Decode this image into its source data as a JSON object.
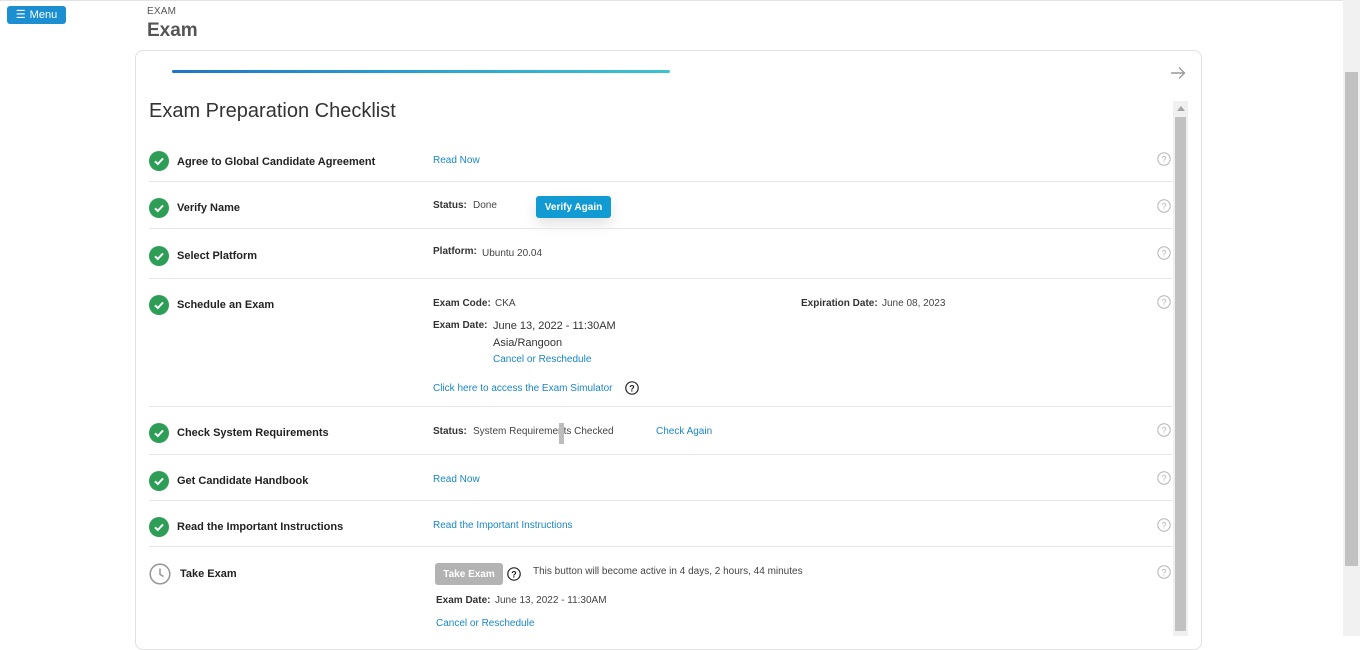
{
  "header": {
    "menu_label": "Menu",
    "breadcrumb": "EXAM",
    "title": "Exam"
  },
  "checklist": {
    "title": "Exam Preparation Checklist",
    "progress_fraction": 0.5,
    "items": [
      {
        "label": "Agree to Global Candidate Agreement",
        "status": "done",
        "link": "Read Now"
      },
      {
        "label": "Verify Name",
        "status": "done",
        "status_key": "Status:",
        "status_value": "Done",
        "button": "Verify Again"
      },
      {
        "label": "Select Platform",
        "status": "done",
        "platform_key": "Platform:",
        "platform_value": "Ubuntu 20.04"
      },
      {
        "label": "Schedule an Exam",
        "status": "done",
        "exam_code_key": "Exam Code:",
        "exam_code_value": "CKA",
        "expiration_key": "Expiration Date:",
        "expiration_value": "June 08, 2023",
        "exam_date_key": "Exam Date:",
        "exam_date_value": "June 13, 2022 - 11:30AM",
        "timezone": "Asia/Rangoon",
        "reschedule_link": "Cancel or Reschedule",
        "simulator_link": "Click here to access the Exam Simulator"
      },
      {
        "label": "Check System Requirements",
        "status": "done",
        "status_key": "Status:",
        "status_value": "System Requirements Checked",
        "link": "Check Again"
      },
      {
        "label": "Get Candidate Handbook",
        "status": "done",
        "link": "Read Now"
      },
      {
        "label": "Read the Important Instructions",
        "status": "done",
        "link": "Read the Important Instructions"
      },
      {
        "label": "Take Exam",
        "status": "pending",
        "button": "Take Exam",
        "note": "This button will become active in 4 days, 2 hours, 44 minutes",
        "exam_date_key": "Exam Date:",
        "exam_date_value": "June 13, 2022 - 11:30AM",
        "reschedule_link": "Cancel or Reschedule"
      }
    ]
  },
  "icons": {
    "menu": "hamburger-icon",
    "next": "arrow-right-icon",
    "done": "check-circle-icon",
    "pending": "clock-icon",
    "help": "question-circle-icon"
  },
  "colors": {
    "primary": "#129ad3",
    "done_green": "#2e9e57",
    "link": "#1a86c7",
    "disabled": "#b3b3b3"
  }
}
